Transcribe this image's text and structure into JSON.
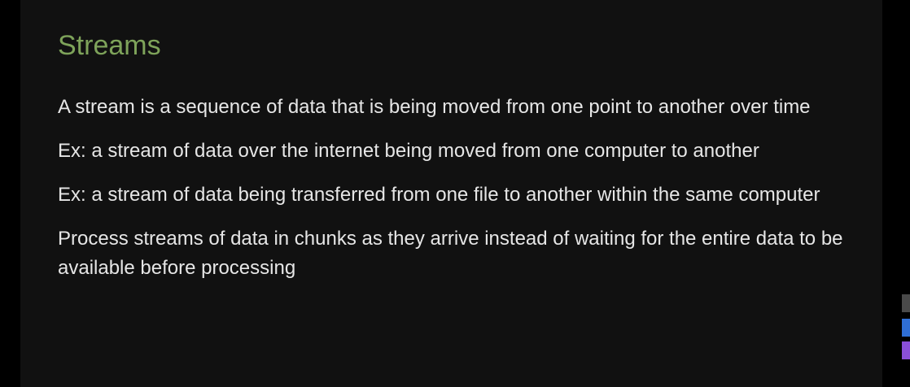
{
  "slide": {
    "title": "Streams",
    "bullets": [
      "A stream is a sequence of data that is being moved from one point to another over time",
      "Ex: a stream of data over the internet being moved from one computer to another",
      "Ex: a stream of data being transferred from one file to another within the same computer",
      "Process streams of data in chunks as they arrive instead of waiting for the entire data to be available before processing"
    ]
  },
  "colors": {
    "background": "#000000",
    "slide_background": "#111111",
    "title": "#7ea35a",
    "text": "#e6e6e6"
  },
  "edge_widgets": [
    {
      "icon": "square-gray-icon",
      "color": "#4a4a4a"
    },
    {
      "icon": "square-blue-icon",
      "color": "#2f6fd6"
    },
    {
      "icon": "square-purple-icon",
      "color": "#8a4fd8"
    }
  ]
}
